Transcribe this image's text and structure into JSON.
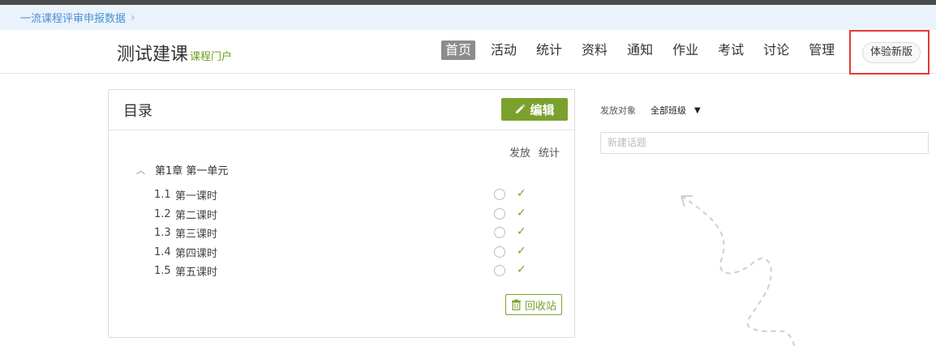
{
  "breadcrumb": {
    "label": "一流课程评审申报数据",
    "separator": "›"
  },
  "header": {
    "course_title": "测试建课",
    "course_subtitle": "课程门户",
    "nav": [
      {
        "label": "首页",
        "active": true
      },
      {
        "label": "活动",
        "active": false
      },
      {
        "label": "统计",
        "active": false
      },
      {
        "label": "资料",
        "active": false
      },
      {
        "label": "通知",
        "active": false
      },
      {
        "label": "作业",
        "active": false
      },
      {
        "label": "考试",
        "active": false
      },
      {
        "label": "讨论",
        "active": false
      },
      {
        "label": "管理",
        "active": false
      }
    ],
    "new_version_label": "体验新版"
  },
  "catalog": {
    "title": "目录",
    "edit_label": "编辑",
    "col_publish": "发放",
    "col_stats": "统计",
    "chapter_label": "第1章 第一单元",
    "lessons": [
      {
        "num": "1.1",
        "title": "第一课时"
      },
      {
        "num": "1.2",
        "title": "第二课时"
      },
      {
        "num": "1.3",
        "title": "第三课时"
      },
      {
        "num": "1.4",
        "title": "第四课时"
      },
      {
        "num": "1.5",
        "title": "第五课时"
      }
    ],
    "recycle_label": "回收站"
  },
  "discussion": {
    "target_label": "发放对象",
    "target_value": "全部班级",
    "topic_placeholder": "新建话题"
  },
  "colors": {
    "accent_green": "#7aa12e",
    "highlight_red": "#e53935",
    "link_blue": "#4a8fd6"
  }
}
